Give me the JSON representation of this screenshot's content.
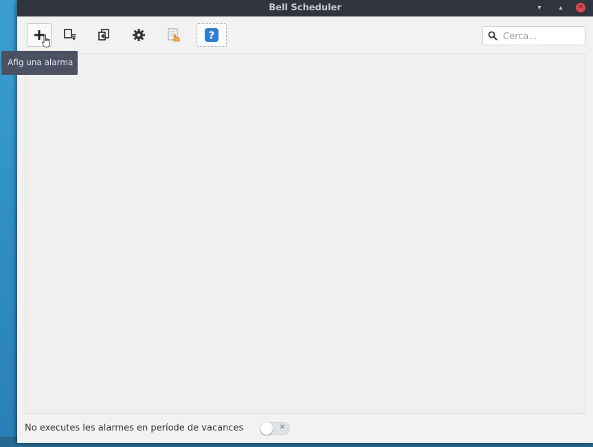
{
  "window": {
    "title": "Bell Scheduler",
    "controls": {
      "minimize": "▾",
      "maximize": "▴",
      "close": "✕"
    }
  },
  "toolbar": {
    "buttons": [
      {
        "id": "add-alarm",
        "icon": "plus-icon",
        "tooltip": "Afig una alarma"
      },
      {
        "id": "import",
        "icon": "import-icon"
      },
      {
        "id": "export",
        "icon": "export-icon"
      },
      {
        "id": "settings",
        "icon": "gear-icon"
      },
      {
        "id": "manual",
        "icon": "hand-document-icon"
      },
      {
        "id": "help",
        "icon": "help-icon",
        "label": "?"
      }
    ],
    "tooltip": "Afig una alarma"
  },
  "search": {
    "placeholder": "Cerca...",
    "value": ""
  },
  "footer": {
    "holidays_label": "No executes les alarmes en període de vacances",
    "holidays_toggle": {
      "state": "off",
      "symbol": "✕"
    }
  },
  "colors": {
    "titlebar": "#2f343f",
    "close_button": "#e0464b",
    "window_bg": "#f2f2f2",
    "help_blue": "#2b7fd4",
    "tooltip_bg": "#4b5162"
  }
}
